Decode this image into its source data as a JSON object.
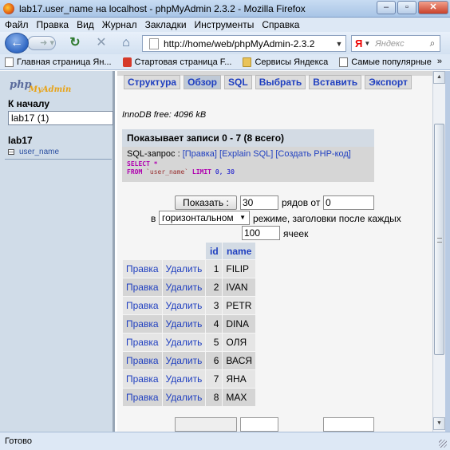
{
  "window": {
    "title": "lab17.user_name на localhost - phpMyAdmin 2.3.2 - Mozilla Firefox",
    "controls": {
      "minimize": "–",
      "maximize": "▫",
      "close": "✕"
    }
  },
  "menu": [
    "Файл",
    "Правка",
    "Вид",
    "Журнал",
    "Закладки",
    "Инструменты",
    "Справка"
  ],
  "nav": {
    "url": "http://home/web/phpMyAdmin-2.3.2",
    "search_placeholder": "Яндекс",
    "search_engine_letter": "Я"
  },
  "bookmarks": [
    {
      "label": "Главная страница Ян...",
      "icon": "page"
    },
    {
      "label": "Стартовая страница F...",
      "icon": "red"
    },
    {
      "label": "Сервисы Яндекса",
      "icon": "folder"
    },
    {
      "label": "Самые популярные",
      "icon": "page"
    }
  ],
  "bookmarks_more": "»",
  "sidebar": {
    "logo_php": "php",
    "logo_myadmin": "MyAdmin",
    "home_link": "К началу",
    "db_select": "lab17 (1)",
    "db_name": "lab17",
    "tables": [
      "user_name"
    ]
  },
  "tabs": [
    {
      "label": "Структура",
      "active": false
    },
    {
      "label": "Обзор",
      "active": true
    },
    {
      "label": "SQL",
      "active": false
    },
    {
      "label": "Выбрать",
      "active": false
    },
    {
      "label": "Вставить",
      "active": false
    },
    {
      "label": "Экспорт",
      "active": false
    }
  ],
  "main": {
    "innodb_free": "InnoDB free: 4096 kB",
    "records_header": "Показывает записи 0 - 7 (8 всего)",
    "sql_label": "SQL-запрос : ",
    "sql_links": [
      "[Правка]",
      "[Explain SQL]",
      "[Создать PHP-код]"
    ],
    "sql_select": "SELECT *",
    "sql_from": "FROM",
    "sql_table": "`user_name`",
    "sql_limit": "LIMIT",
    "sql_limit_values": "0, 30",
    "show_button": "Показать :",
    "rows_value": "30",
    "rows_label": "рядов от",
    "from_value": "0",
    "in_label": "в",
    "mode_value": "горизонтальном",
    "mode_label": "режиме, заголовки после каждых",
    "cells_value": "100",
    "cells_label": "ячеек"
  },
  "table": {
    "columns": [
      "id",
      "name"
    ],
    "edit_label": "Правка",
    "delete_label": "Удалить",
    "rows": [
      {
        "id": "1",
        "name": "FILIP"
      },
      {
        "id": "2",
        "name": "IVAN"
      },
      {
        "id": "3",
        "name": "PETR"
      },
      {
        "id": "4",
        "name": "DINA"
      },
      {
        "id": "5",
        "name": "ОЛЯ"
      },
      {
        "id": "6",
        "name": "ВАСЯ"
      },
      {
        "id": "7",
        "name": "ЯНА"
      },
      {
        "id": "8",
        "name": "MAX"
      }
    ]
  },
  "status": "Готово"
}
